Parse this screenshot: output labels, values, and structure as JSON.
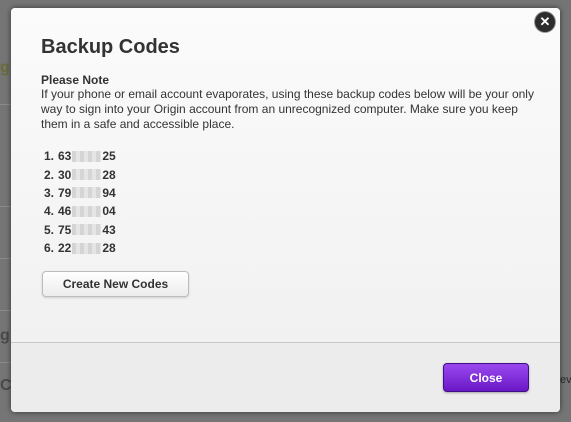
{
  "background": {
    "fragments": [
      "g",
      "C",
      "ev"
    ]
  },
  "dialog": {
    "title": "Backup Codes",
    "close_icon": "close-icon",
    "note": {
      "heading": "Please Note",
      "text": "If your phone or email account evaporates, using these backup codes below will be your only way to sign into your Origin account from an unrecognized computer. Make sure you keep them in a safe and accessible place."
    },
    "codes": [
      {
        "number": "1.",
        "prefix": "63",
        "suffix": "25"
      },
      {
        "number": "2.",
        "prefix": "30",
        "suffix": "28"
      },
      {
        "number": "3.",
        "prefix": "79",
        "suffix": "94"
      },
      {
        "number": "4.",
        "prefix": "46",
        "suffix": "04"
      },
      {
        "number": "5.",
        "prefix": "75",
        "suffix": "43"
      },
      {
        "number": "6.",
        "prefix": "22",
        "suffix": "28"
      }
    ],
    "create_button_label": "Create New Codes",
    "close_button_label": "Close"
  },
  "colors": {
    "overlay": "#757575",
    "dialog_bg": "#f2f2f2",
    "primary_button": "#7b2ed8",
    "text": "#333333"
  }
}
